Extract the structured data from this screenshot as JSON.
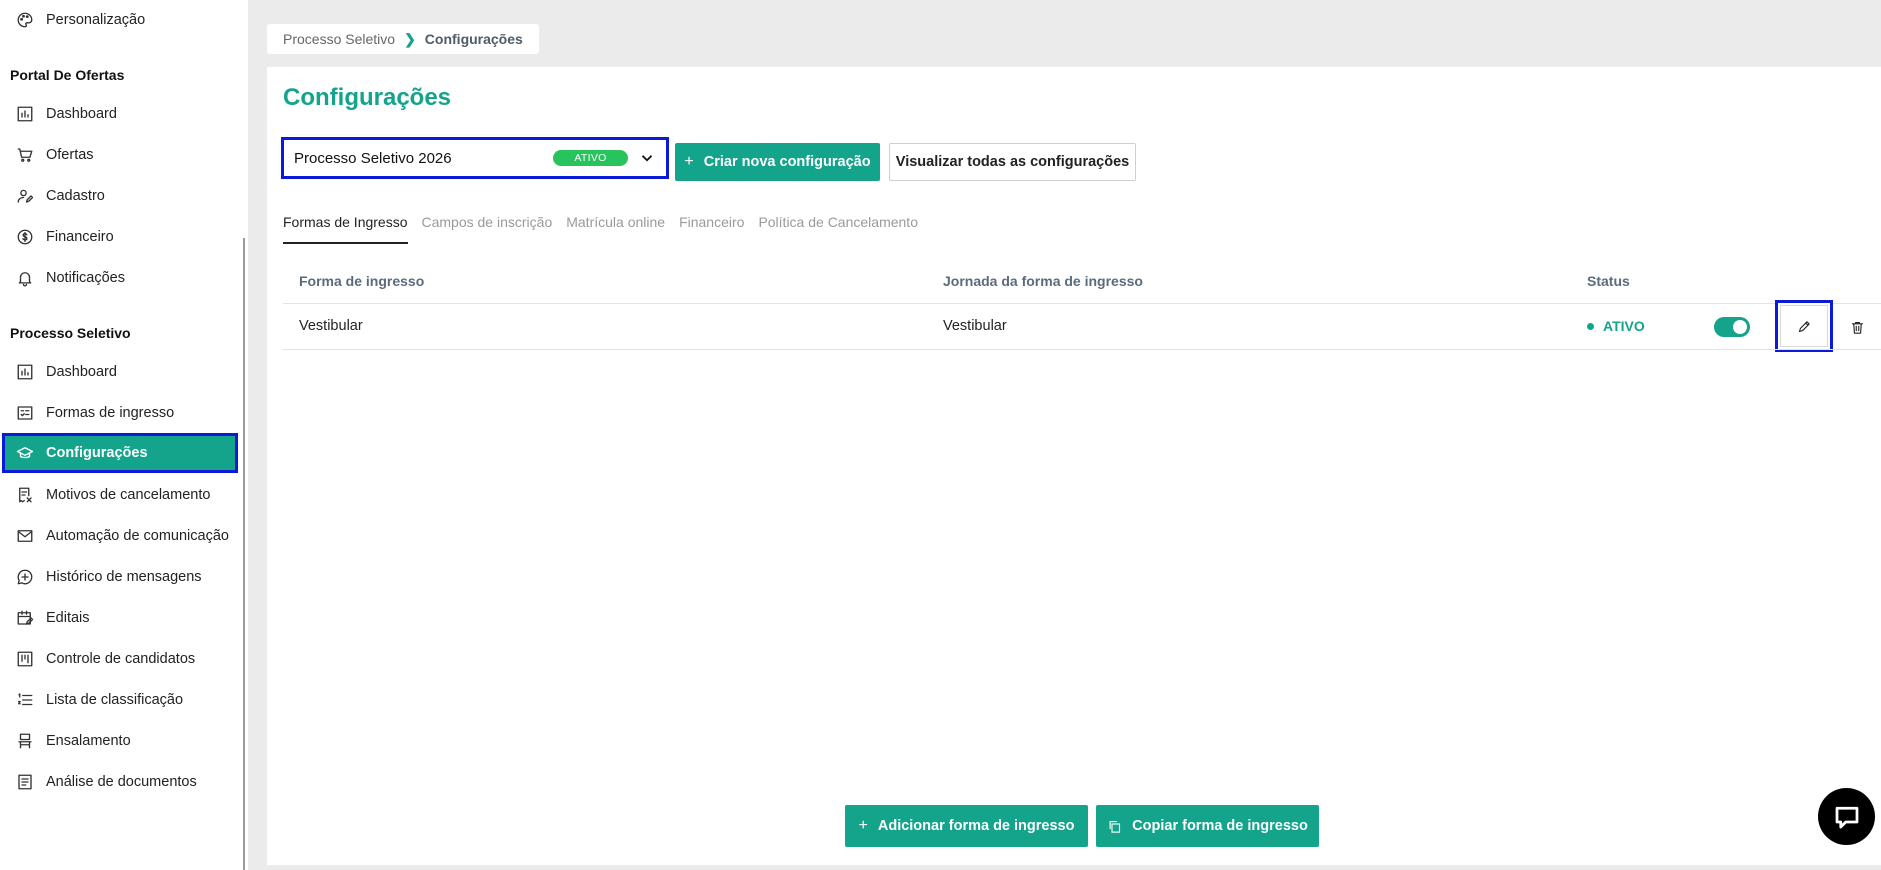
{
  "sidebar": {
    "top_items": [
      {
        "label": "Personalização",
        "icon": "palette-icon"
      }
    ],
    "sections": [
      {
        "title": "Portal De Ofertas",
        "items": [
          {
            "label": "Dashboard",
            "icon": "chart-icon"
          },
          {
            "label": "Ofertas",
            "icon": "cart-icon"
          },
          {
            "label": "Cadastro",
            "icon": "user-edit-icon"
          },
          {
            "label": "Financeiro",
            "icon": "dollar-icon"
          },
          {
            "label": "Notificações",
            "icon": "bell-icon"
          }
        ]
      },
      {
        "title": "Processo Seletivo",
        "items": [
          {
            "label": "Dashboard",
            "icon": "chart-icon"
          },
          {
            "label": "Formas de ingresso",
            "icon": "form-list-icon"
          },
          {
            "label": "Configurações",
            "icon": "graduation-cap-icon",
            "active": true
          },
          {
            "label": "Motivos de cancelamento",
            "icon": "receipt-cancel-icon"
          },
          {
            "label": "Automação de comunicação",
            "icon": "mail-icon"
          },
          {
            "label": "Histórico de mensagens",
            "icon": "message-plus-icon"
          },
          {
            "label": "Editais",
            "icon": "calendar-edit-icon"
          },
          {
            "label": "Controle de candidatos",
            "icon": "board-icon"
          },
          {
            "label": "Lista de classificação",
            "icon": "ordered-list-icon"
          },
          {
            "label": "Ensalamento",
            "icon": "seat-icon"
          },
          {
            "label": "Análise de documentos",
            "icon": "document-icon"
          }
        ]
      }
    ]
  },
  "breadcrumb": {
    "parent": "Processo Seletivo",
    "current": "Configurações"
  },
  "page": {
    "title": "Configurações"
  },
  "config_select": {
    "value": "Processo Seletivo 2026",
    "badge": "ATIVO"
  },
  "buttons": {
    "create_new": "Criar nova configuração",
    "view_all": "Visualizar todas as configurações",
    "add_ingresso": "Adicionar forma de ingresso",
    "copy_ingresso": "Copiar forma de ingresso"
  },
  "tabs": [
    {
      "label": "Formas de Ingresso",
      "active": true
    },
    {
      "label": "Campos de inscrição"
    },
    {
      "label": "Matrícula online"
    },
    {
      "label": "Financeiro"
    },
    {
      "label": "Política de Cancelamento"
    }
  ],
  "table": {
    "headers": [
      "Forma de ingresso",
      "Jornada da forma de ingresso",
      "Status"
    ],
    "rows": [
      {
        "forma": "Vestibular",
        "jornada": "Vestibular",
        "status": "ATIVO",
        "enabled": true
      }
    ]
  },
  "colors": {
    "accent": "#14a38b",
    "badge_green": "#27c45d",
    "highlight_border": "#0a1ad6"
  }
}
